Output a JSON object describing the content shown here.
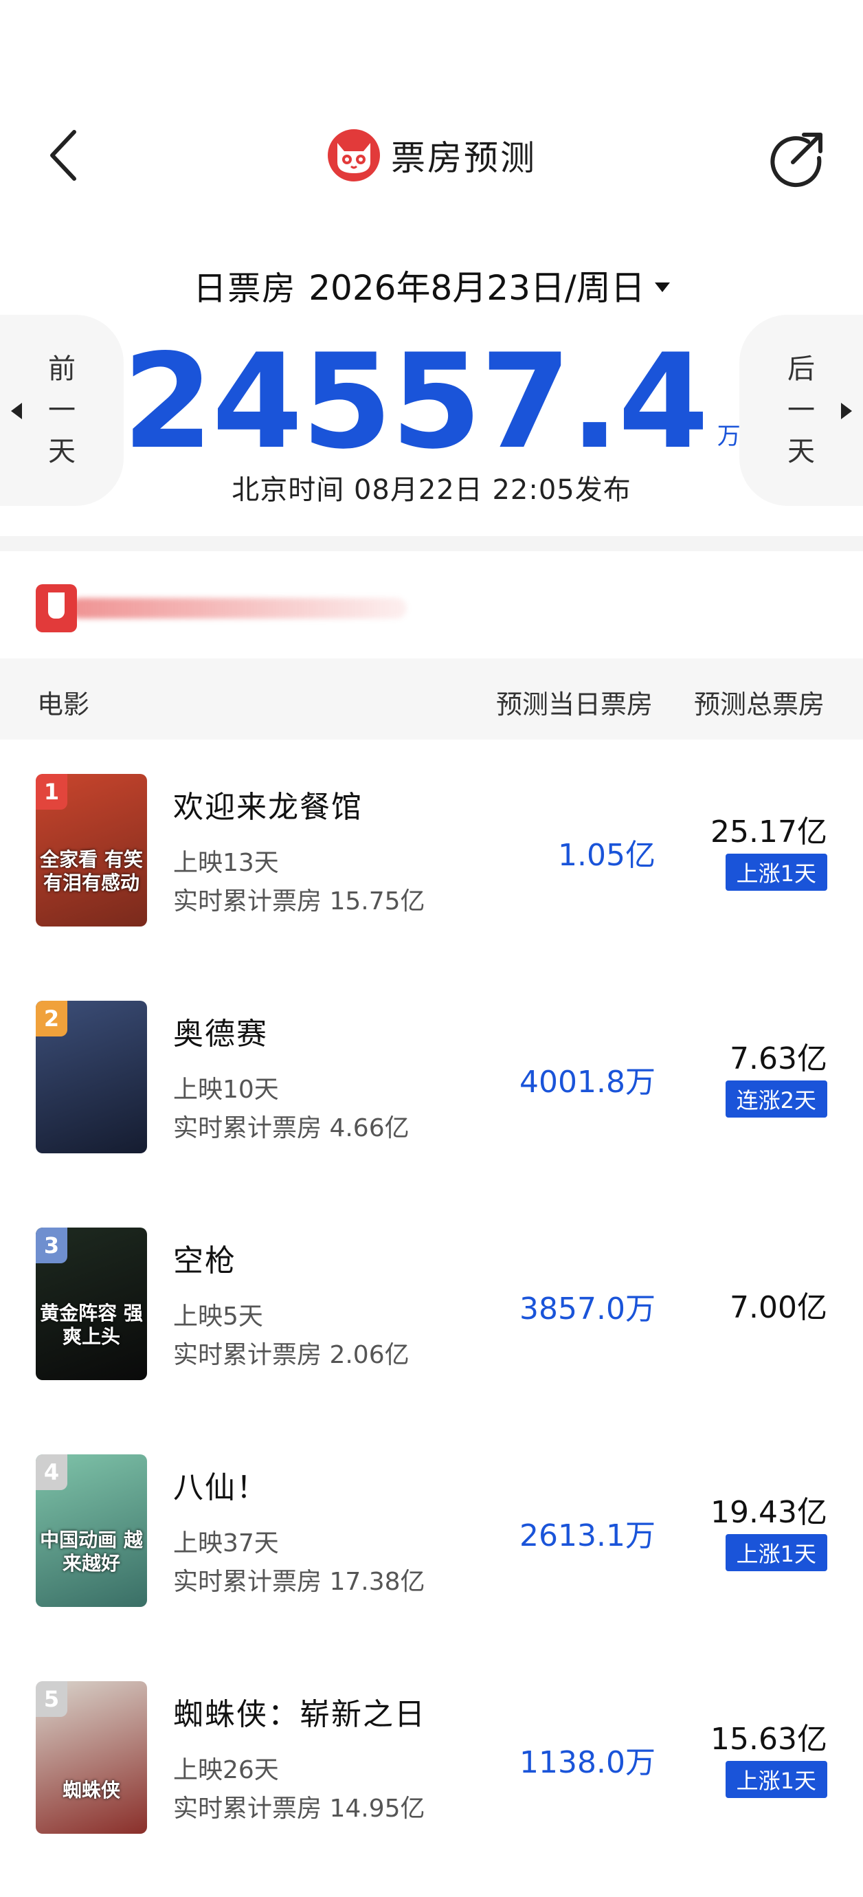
{
  "header": {
    "title": "票房预测",
    "back_icon": "chevron-left-icon",
    "share_icon": "share-arrow-icon",
    "logo_icon": "maoyan-cat-logo",
    "brand_color": "#e23a3a"
  },
  "date": {
    "label": "日票房",
    "value": "2026年8月23日/周日"
  },
  "nav": {
    "prev": [
      "前",
      "一",
      "天"
    ],
    "next": [
      "后",
      "一",
      "天"
    ]
  },
  "summary": {
    "value": "24557.4",
    "unit": "万",
    "release_note": "北京时间  08月22日  22:05发布",
    "accent_color": "#1a54d9"
  },
  "table": {
    "headers": {
      "movie": "电影",
      "day": "预测当日票房",
      "total": "预测总票房"
    },
    "rows": [
      {
        "rank": "1",
        "rank_color": "#e2453c",
        "name": "欢迎来龙餐馆",
        "days": "上映13天",
        "cumulative": "实时累计票房 15.75亿",
        "day_value": "1.05亿",
        "total_value": "25.17亿",
        "trend": "上涨1天",
        "poster_caption": "全家看 有笑有泪有感动",
        "poster_colors": [
          "#c8452d",
          "#7a2a1c"
        ]
      },
      {
        "rank": "2",
        "rank_color": "#f0a13b",
        "name": "奥德赛",
        "days": "上映10天",
        "cumulative": "实时累计票房 4.66亿",
        "day_value": "4001.8万",
        "total_value": "7.63亿",
        "trend": "连涨2天",
        "poster_caption": "",
        "poster_colors": [
          "#3c4e78",
          "#151c30"
        ]
      },
      {
        "rank": "3",
        "rank_color": "#6f8fcf",
        "name": "空枪",
        "days": "上映5天",
        "cumulative": "实时累计票房 2.06亿",
        "day_value": "3857.0万",
        "total_value": "7.00亿",
        "trend": "",
        "poster_caption": "黄金阵容 强爽上头",
        "poster_colors": [
          "#1e2a20",
          "#0a0a0a"
        ]
      },
      {
        "rank": "4",
        "rank_color": "#cfcfcf",
        "name": "八仙！",
        "days": "上映37天",
        "cumulative": "实时累计票房 17.38亿",
        "day_value": "2613.1万",
        "total_value": "19.43亿",
        "trend": "上涨1天",
        "poster_caption": "中国动画 越来越好",
        "poster_colors": [
          "#7fc3a9",
          "#3a6f66"
        ]
      },
      {
        "rank": "5",
        "rank_color": "#cfcfcf",
        "name": "蜘蛛侠：崭新之日",
        "days": "上映26天",
        "cumulative": "实时累计票房 14.95亿",
        "day_value": "1138.0万",
        "total_value": "15.63亿",
        "trend": "上涨1天",
        "poster_caption": "蜘蛛侠",
        "poster_colors": [
          "#d9d4cc",
          "#8a2f2a"
        ]
      }
    ]
  }
}
